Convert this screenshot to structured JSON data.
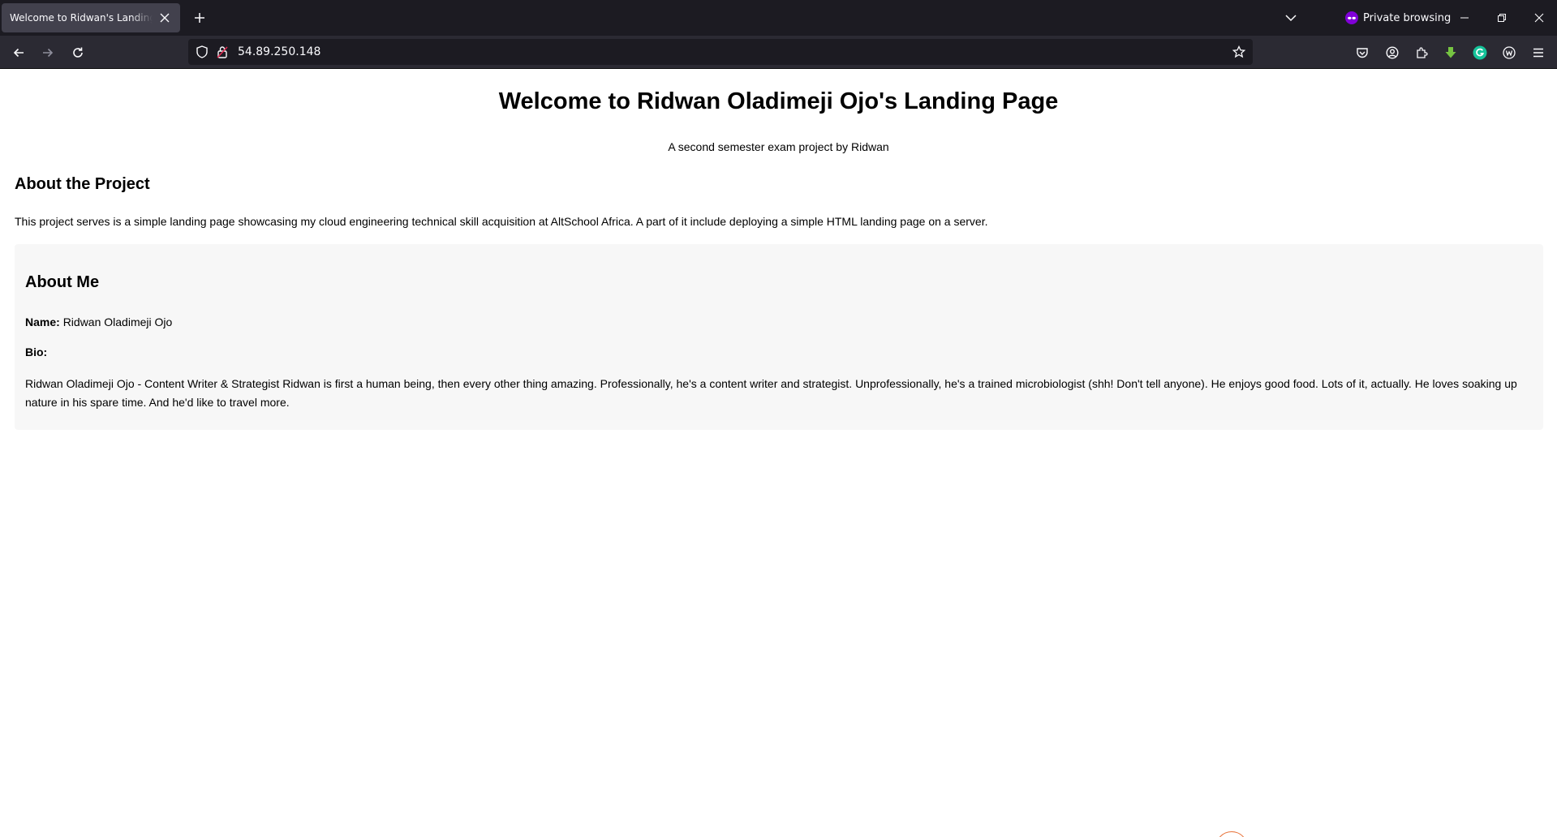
{
  "browser": {
    "tab_title": "Welcome to Ridwan's Landing Page",
    "private_label": "Private browsing",
    "url": "54.89.250.148",
    "accent_color": "#8000d7"
  },
  "page": {
    "title": "Welcome to Ridwan Oladimeji Ojo's Landing Page",
    "subtitle": "A second semester exam project by Ridwan",
    "project_heading": "About the Project",
    "project_text": "This project serves is a simple landing page showcasing my cloud engineering technical skill acquisition at AltSchool Africa. A part of it include deploying a simple HTML landing page on a server.",
    "about_heading": "About Me",
    "name_label": "Name:",
    "name_value": "Ridwan Oladimeji Ojo",
    "bio_label": "Bio:",
    "bio_text": "Ridwan Oladimeji Ojo - Content Writer & Strategist Ridwan is first a human being, then every other thing amazing. Professionally, he's a content writer and strategist. Unprofessionally, he's a trained microbiologist (shh! Don't tell anyone). He enjoys good food. Lots of it, actually. He loves soaking up nature in his spare time. And he'd like to travel more."
  }
}
